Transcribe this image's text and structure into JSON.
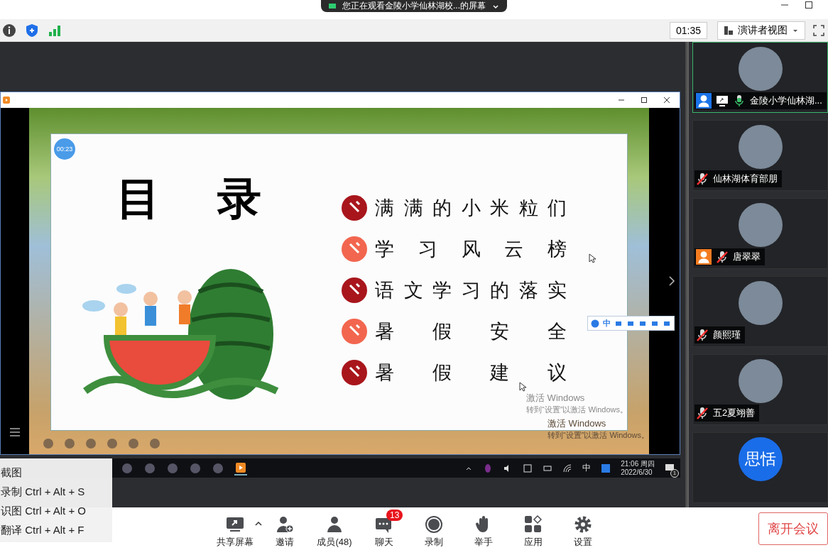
{
  "banner": {
    "text": "您正在观看金陵小学仙林湖校...的屏幕"
  },
  "toolbar": {
    "timer": "01:35",
    "view_button": "演讲者视图"
  },
  "shared_window": {
    "slide": {
      "timer": "00:23",
      "title": "目录",
      "items": [
        {
          "label": "满满的小米粒们",
          "color": "#a8161c"
        },
        {
          "label": "学习风云榜",
          "color": "#f2664f"
        },
        {
          "label": "语文学习的落实",
          "color": "#a8161c"
        },
        {
          "label": "暑假安全",
          "color": "#f2664f"
        },
        {
          "label": "暑假建议",
          "color": "#a8161c"
        }
      ]
    },
    "watermarks": [
      {
        "title": "激活 Windows",
        "hint": "转到“设置”以激活 Windows。"
      },
      {
        "title": "激活 Windows",
        "hint": "转到“设置”以激活 Windows。"
      }
    ]
  },
  "ime_bar": {
    "label": "中"
  },
  "shared_taskbar": {
    "ime": "中",
    "time": "21:06 周四",
    "date": "2022/6/30",
    "notification_count": "1"
  },
  "participants": [
    {
      "name": "金陵小学仙林湖...",
      "color": "#1a73e8",
      "muted": false,
      "sharing": true,
      "selected": true
    },
    {
      "name": "仙林湖体育部朋",
      "muted": true,
      "sharing": false,
      "selected": false
    },
    {
      "name": "唐翠翠",
      "color": "#f47b20",
      "muted": true,
      "sharing": false,
      "selected": false
    },
    {
      "name": "颜熙瑾",
      "muted": true,
      "sharing": false,
      "selected": false
    },
    {
      "name": "五2夏翊善",
      "muted": true,
      "sharing": false,
      "selected": false
    },
    {
      "avatar_text": "思恬",
      "selected": false
    }
  ],
  "context_menu": {
    "items": [
      "截图",
      "录制 Ctrl + Alt + S",
      "识图 Ctrl + Alt + O",
      "翻译 Ctrl + Alt + F"
    ]
  },
  "bottom_bar": {
    "buttons": [
      {
        "kind": "share",
        "label": "共享屏幕"
      },
      {
        "kind": "invite",
        "label": "邀请"
      },
      {
        "kind": "members",
        "label": "成员(48)"
      },
      {
        "kind": "chat",
        "label": "聊天",
        "badge": "13"
      },
      {
        "kind": "record",
        "label": "录制"
      },
      {
        "kind": "hand",
        "label": "举手"
      },
      {
        "kind": "apps",
        "label": "应用"
      },
      {
        "kind": "settings",
        "label": "设置"
      }
    ],
    "leave_button": "离开会议"
  }
}
